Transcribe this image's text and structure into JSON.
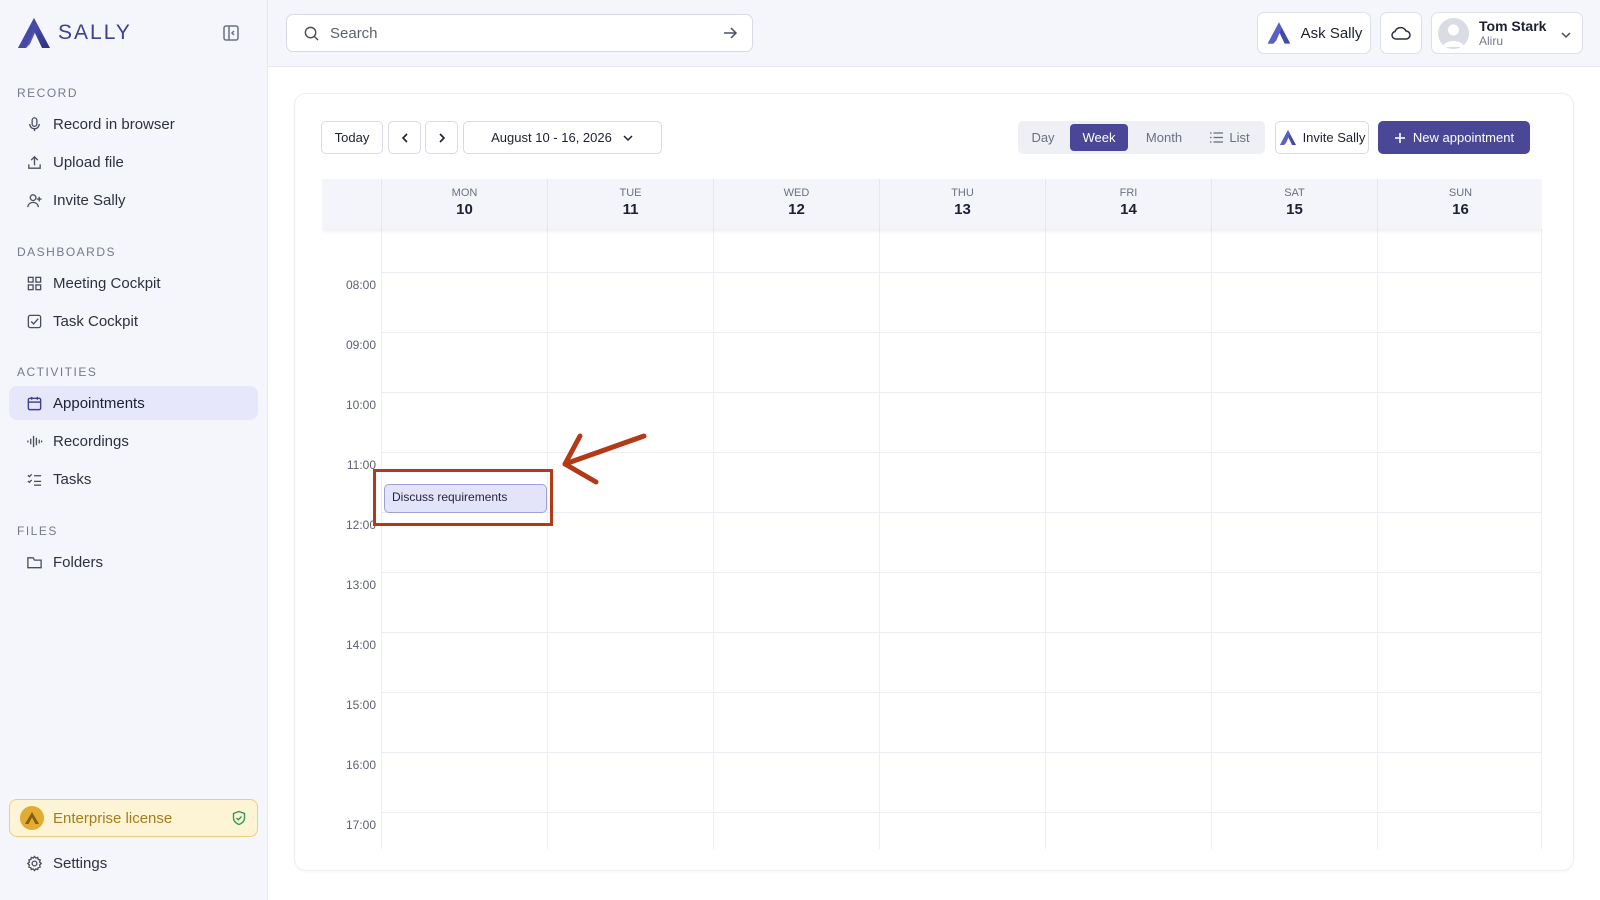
{
  "app": {
    "name": "SALLY"
  },
  "sidebar": {
    "sections": {
      "record": "RECORD",
      "dashboards": "DASHBOARDS",
      "activities": "ACTIVITIES",
      "files": "FILES"
    },
    "items": {
      "record_in_browser": "Record in browser",
      "upload_file": "Upload file",
      "invite_sally": "Invite Sally",
      "meeting_cockpit": "Meeting Cockpit",
      "task_cockpit": "Task Cockpit",
      "appointments": "Appointments",
      "recordings": "Recordings",
      "tasks": "Tasks",
      "folders": "Folders",
      "settings": "Settings"
    },
    "active_item": "appointments",
    "license": "Enterprise license"
  },
  "topbar": {
    "search_placeholder": "Search",
    "ask_label": "Ask Sally",
    "user": {
      "name": "Tom Stark",
      "org": "Aliru"
    }
  },
  "toolbar": {
    "today": "Today",
    "date_range": "August 10 - 16, 2026",
    "views": {
      "day": "Day",
      "week": "Week",
      "month": "Month",
      "list": "List"
    },
    "active_view": "week",
    "invite_label": "Invite Sally",
    "new_label": "New appointment"
  },
  "calendar": {
    "days": [
      {
        "name": "MON",
        "num": "10"
      },
      {
        "name": "TUE",
        "num": "11"
      },
      {
        "name": "WED",
        "num": "12"
      },
      {
        "name": "THU",
        "num": "13"
      },
      {
        "name": "FRI",
        "num": "14"
      },
      {
        "name": "SAT",
        "num": "15"
      },
      {
        "name": "SUN",
        "num": "16"
      }
    ],
    "times": [
      "08:00",
      "09:00",
      "10:00",
      "11:00",
      "12:00",
      "13:00",
      "14:00",
      "15:00",
      "16:00",
      "17:00"
    ],
    "events": [
      {
        "title": "Discuss requirements",
        "day": "MON",
        "start": "11:00"
      }
    ]
  },
  "colors": {
    "accent": "#4a4797",
    "event_bg": "#e3e4fa",
    "annotation": "#b33a17",
    "license_bg": "#fdf3d5"
  }
}
